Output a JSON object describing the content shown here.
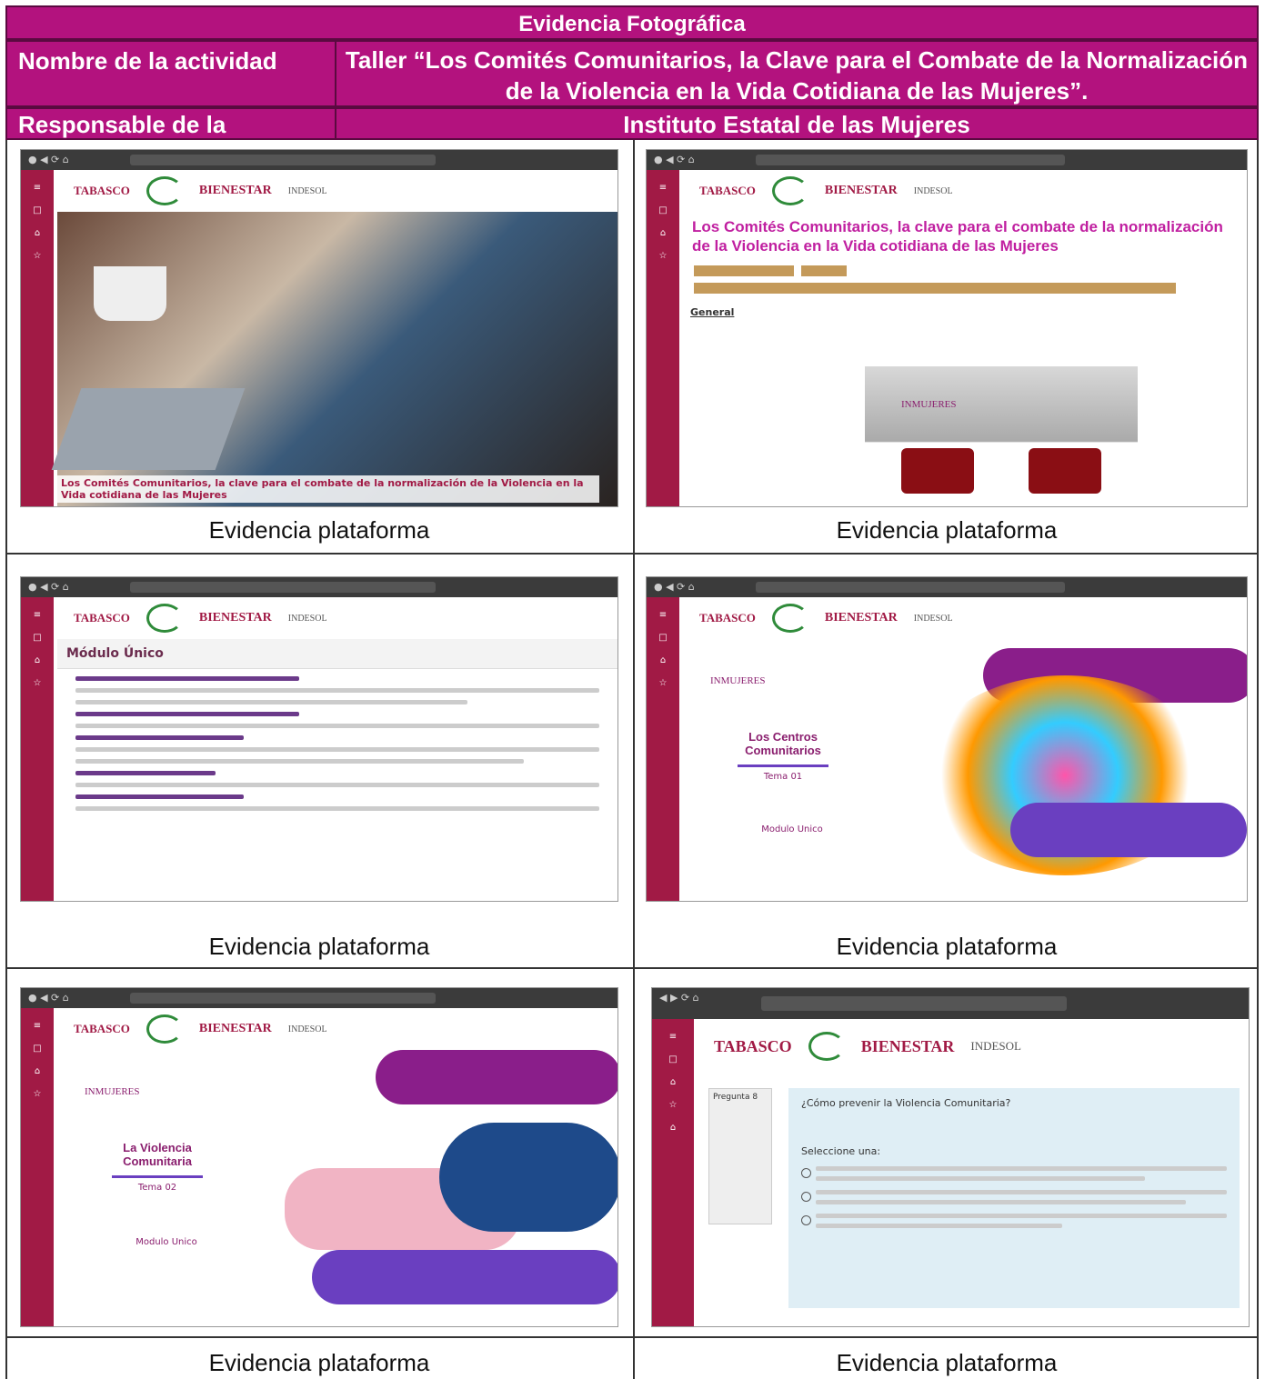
{
  "header": {
    "title": "Evidencia Fotográfica",
    "activity_label": "Nombre de la actividad",
    "activity_value_line1": "Taller “Los Comités Comunitarios, la Clave para el Combate de la Normalización",
    "activity_value_line2": "de la Violencia en la Vida Cotidiana de las Mujeres”.",
    "responsible_label": "Responsable de la actividad",
    "responsible_value": "Instituto Estatal de las Mujeres"
  },
  "captions": [
    "Evidencia plataforma",
    "Evidencia plataforma",
    "Evidencia plataforma",
    "Evidencia plataforma",
    "Evidencia plataforma",
    "Evidencia plataforma"
  ],
  "shots": {
    "logo_tabasco": "TABASCO",
    "logo_bienestar": "BIENESTAR",
    "logo_indesol": "INDESOL",
    "s1_caption": "Los Comités Comunitarios, la clave para el combate de la normalización de la Violencia en la Vida cotidiana de las Mujeres",
    "s2_title": "Los Comités Comunitarios, la clave para el combate de la normalización de la Violencia en la Vida cotidiana de las Mujeres",
    "s2_section": "General",
    "s2_inmujeres": "INMUJERES",
    "s3_title": "Módulo Único",
    "s4_inmujeres": "INMUJERES",
    "s4_title": "Los Centros Comunitarios",
    "s4_tema": "Tema 01",
    "s4_modulo": "Modulo Unico",
    "s5_inmujeres": "INMUJERES",
    "s5_title": "La Violencia Comunitaria",
    "s5_tema": "Tema 02",
    "s5_modulo": "Modulo Unico",
    "s6_pregunta": "Pregunta 8",
    "s6_question": "¿Cómo prevenir la Violencia Comunitaria?",
    "s6_select": "Seleccione una:"
  }
}
